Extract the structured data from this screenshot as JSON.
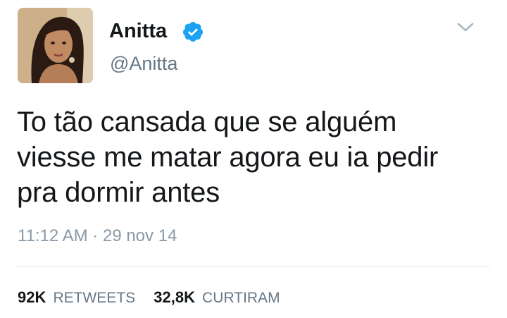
{
  "author": {
    "display_name": "Anitta",
    "handle": "@Anitta",
    "verified_icon": "verified-badge-icon",
    "verified_color": "#1da1f2"
  },
  "menu_icon": "chevron-down-icon",
  "tweet": {
    "text_lines": [
      "To tão cansada que se alguém",
      "viesse me matar agora eu ia pedir",
      "pra dormir antes"
    ],
    "time": "11:12 AM",
    "separator": "·",
    "date": "29 nov 14"
  },
  "stats": {
    "retweets_count": "92K",
    "retweets_label": "RETWEETS",
    "likes_count": "32,8K",
    "likes_label": "CURTIRAM"
  }
}
